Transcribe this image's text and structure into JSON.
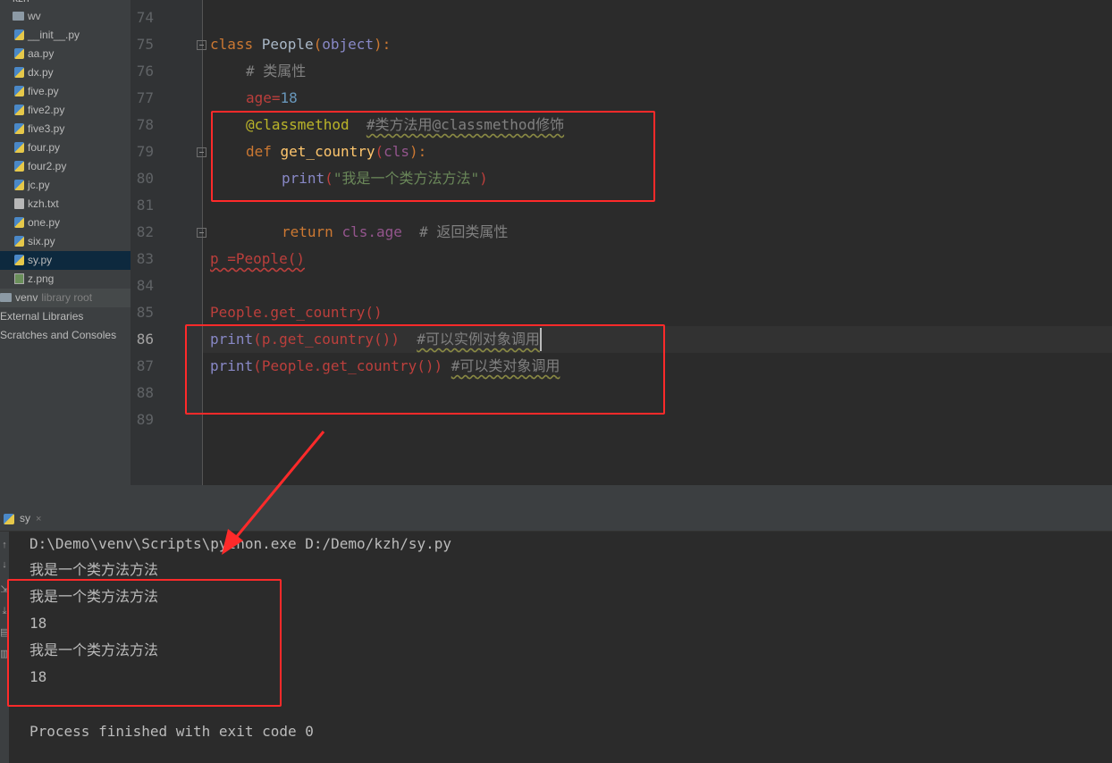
{
  "sidebar": {
    "top_folder": "kzh",
    "folder_wv": "wv",
    "files": [
      "__init__.py",
      "aa.py",
      "dx.py",
      "five.py",
      "five2.py",
      "five3.py",
      "four.py",
      "four2.py",
      "jc.py",
      "kzh.txt",
      "one.py",
      "six.py",
      "sy.py",
      "z.png"
    ],
    "selected_file": "sy.py",
    "venv": "venv",
    "venv_note": "library root",
    "external": "External Libraries",
    "scratches": "Scratches and Consoles"
  },
  "editor": {
    "line_numbers": [
      "74",
      "75",
      "76",
      "77",
      "78",
      "79",
      "80",
      "81",
      "82",
      "83",
      "84",
      "85",
      "86",
      "87",
      "88",
      "89"
    ],
    "lines": {
      "l75": {
        "kw": "class ",
        "name": "People",
        "open": "(",
        "base": "object",
        "close": "):"
      },
      "l76": {
        "comment": "# 类属性"
      },
      "l77": {
        "name": "age",
        "eq": "=",
        "num": "18"
      },
      "l78": {
        "decorator": "@classmethod",
        "comment": "#类方法用@classmethod修饰"
      },
      "l79": {
        "kw": "def ",
        "fn": "get_country",
        "open": "(",
        "param": "cls",
        "close": "):"
      },
      "l80": {
        "fn": "print",
        "open": "(",
        "str": "\"我是一个类方法方法\"",
        "close": ")"
      },
      "l82": {
        "kw": "return ",
        "obj": "cls",
        "attr": ".age",
        "comment": "# 返回类属性"
      },
      "l83": {
        "text": "p =People()"
      },
      "l85": {
        "text": "People.get_country()"
      },
      "l86": {
        "fn": "print",
        "open": "(",
        "call": "p.get_country()",
        "close": ")",
        "comment": "#可以实例对象调用"
      },
      "l87": {
        "fn": "print",
        "open": "(",
        "call": "People.get_country()",
        "close": ")",
        "comment": "#可以类对象调用"
      }
    }
  },
  "run_panel": {
    "tab_label": "sy",
    "close_glyph": "×",
    "output": [
      "D:\\Demo\\venv\\Scripts\\python.exe D:/Demo/kzh/sy.py",
      "我是一个类方法方法",
      "我是一个类方法方法",
      "18",
      "我是一个类方法方法",
      "18",
      "",
      "Process finished with exit code 0"
    ]
  },
  "colors": {
    "annotation": "#ff2a2a",
    "background": "#2b2b2b",
    "keyword": "#cc7832",
    "string": "#6a8759"
  },
  "icons": [
    "python-file-icon",
    "text-file-icon",
    "image-file-icon",
    "folder-icon",
    "close-icon",
    "arrow-icon"
  ]
}
